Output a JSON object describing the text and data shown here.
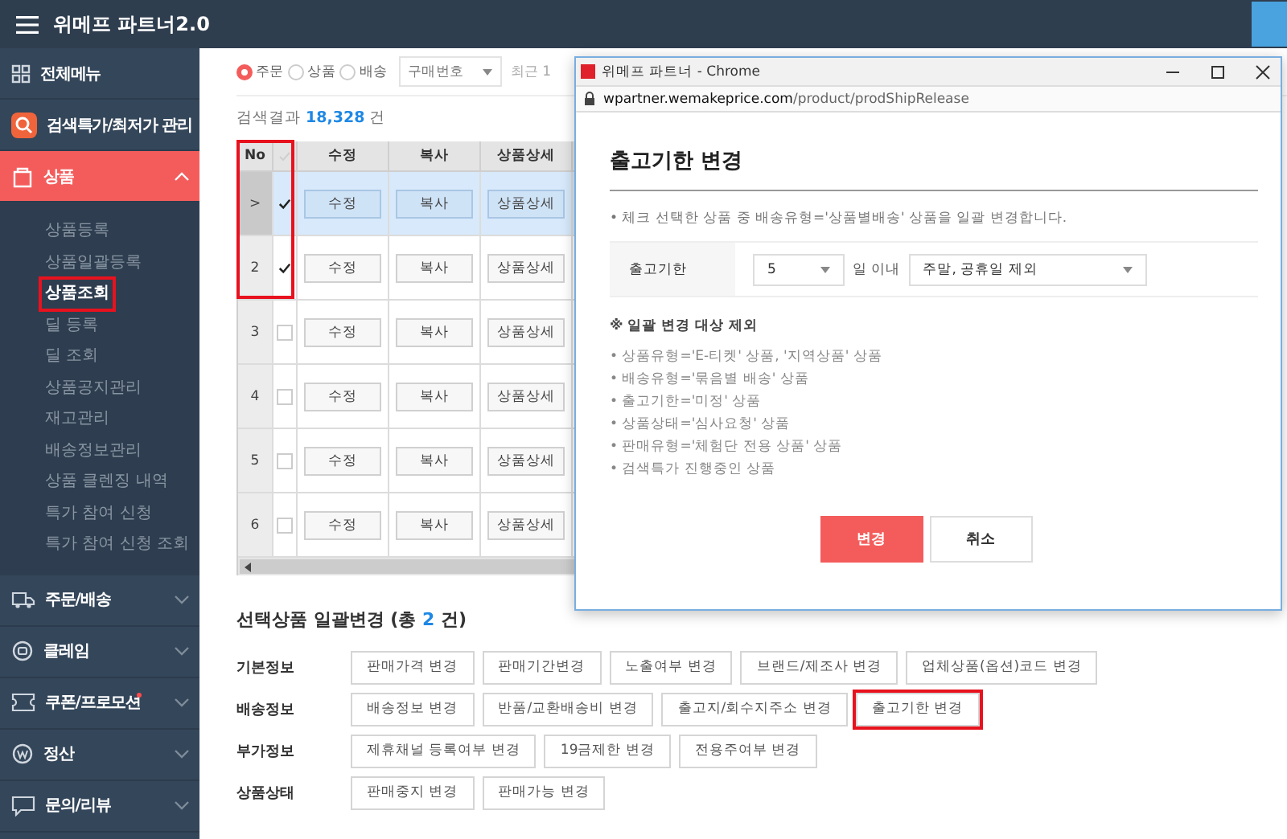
{
  "topbar": {
    "title": "위메프 파트너2.0"
  },
  "sidebar": {
    "items": [
      {
        "label": "전체메뉴",
        "selected": false,
        "new": false
      },
      {
        "label": "검색특가/최저가 관리",
        "selected": false,
        "new": false
      },
      {
        "label": "상품",
        "selected": true,
        "new": false,
        "expanded": true,
        "children": [
          {
            "label": "상품등록",
            "selected": false,
            "highlighted": false
          },
          {
            "label": "상품일괄등록",
            "selected": false,
            "highlighted": false
          },
          {
            "label": "상품조회",
            "selected": true,
            "highlighted": true
          },
          {
            "label": "딜 등록",
            "selected": false,
            "highlighted": false
          },
          {
            "label": "딜 조회",
            "selected": false,
            "highlighted": false
          },
          {
            "label": "상품공지관리",
            "selected": false,
            "highlighted": false
          },
          {
            "label": "재고관리",
            "selected": false,
            "highlighted": false
          },
          {
            "label": "배송정보관리",
            "selected": false,
            "highlighted": false
          },
          {
            "label": "상품 클렌징 내역",
            "selected": false,
            "highlighted": false
          },
          {
            "label": "특가 참여 신청",
            "selected": false,
            "highlighted": false
          },
          {
            "label": "특가 참여 신청 조회",
            "selected": false,
            "highlighted": false
          }
        ]
      },
      {
        "label": "주문/배송",
        "selected": false,
        "new": false,
        "expanded": false
      },
      {
        "label": "클레임",
        "selected": false,
        "new": false,
        "expanded": false
      },
      {
        "label": "쿠폰/프로모션",
        "selected": false,
        "new": true,
        "expanded": false
      },
      {
        "label": "정산",
        "selected": false,
        "new": false,
        "expanded": false
      },
      {
        "label": "문의/리뷰",
        "selected": false,
        "new": false,
        "expanded": false
      }
    ]
  },
  "filter": {
    "radios": [
      {
        "label": "주문",
        "selected": true
      },
      {
        "label": "상품",
        "selected": false
      },
      {
        "label": "배송",
        "selected": false
      }
    ],
    "dropdown": {
      "value": "구매번호"
    },
    "period": "최근 1"
  },
  "result": {
    "label": "검색결과",
    "count": "18,328",
    "unit": "건"
  },
  "table": {
    "columns": [
      "No",
      "수정",
      "복사",
      "상품상세"
    ],
    "rows": [
      {
        "no": ">",
        "checked": true,
        "selected": true,
        "highlighted": true,
        "buttons": [
          "수정",
          "복사",
          "상품상세"
        ]
      },
      {
        "no": "2",
        "checked": true,
        "selected": false,
        "highlighted": true,
        "buttons": [
          "수정",
          "복사",
          "상품상세"
        ]
      },
      {
        "no": "3",
        "checked": false,
        "selected": false,
        "highlighted": false,
        "buttons": [
          "수정",
          "복사",
          "상품상세"
        ]
      },
      {
        "no": "4",
        "checked": false,
        "selected": false,
        "highlighted": false,
        "buttons": [
          "수정",
          "복사",
          "상품상세"
        ]
      },
      {
        "no": "5",
        "checked": false,
        "selected": false,
        "highlighted": false,
        "buttons": [
          "수정",
          "복사",
          "상품상세"
        ]
      },
      {
        "no": "6",
        "checked": false,
        "selected": false,
        "highlighted": false,
        "buttons": [
          "수정",
          "복사",
          "상품상세"
        ]
      }
    ]
  },
  "bulk": {
    "title": "선택상품 일괄변경 (총 **2** 건)",
    "groups": [
      {
        "label": "기본정보",
        "buttons": [
          {
            "label": "판매가격 변경",
            "highlighted": false
          },
          {
            "label": "판매기간변경",
            "highlighted": false
          },
          {
            "label": "노출여부 변경",
            "highlighted": false
          },
          {
            "label": "브랜드/제조사 변경",
            "highlighted": false
          },
          {
            "label": "업체상품(옵션)코드 변경",
            "highlighted": false
          }
        ]
      },
      {
        "label": "배송정보",
        "buttons": [
          {
            "label": "배송정보 변경",
            "highlighted": false
          },
          {
            "label": "반품/교환배송비 변경",
            "highlighted": false
          },
          {
            "label": "출고지/회수지주소 변경",
            "highlighted": false
          },
          {
            "label": "출고기한 변경",
            "highlighted": true
          }
        ]
      },
      {
        "label": "부가정보",
        "buttons": [
          {
            "label": "제휴채널 등록여부 변경",
            "highlighted": false
          },
          {
            "label": "19금제한 변경",
            "highlighted": false
          },
          {
            "label": "전용주여부 변경",
            "highlighted": false
          }
        ]
      },
      {
        "label": "상품상태",
        "buttons": [
          {
            "label": "판매중지 변경",
            "highlighted": false
          },
          {
            "label": "판매가능 변경",
            "highlighted": false
          }
        ]
      }
    ]
  },
  "popup": {
    "title": "위메프 파트너 - Chrome",
    "url_host": "wpartner.wemakeprice.com",
    "url_path": "/product/prodShipRelease",
    "heading": "출고기한 변경",
    "note": "• 체크 선택한 상품 중 배송유형='상품별배송' 상품을 일괄 변경합니다.",
    "form": {
      "label": "출고기한",
      "days": "5",
      "days_unit": "일 이내",
      "option": "주말, 공휴일 제외"
    },
    "exclusions_title": "※ 일괄 변경 대상 제외",
    "exclusions": [
      "• 상품유형='E-티켓' 상품, '지역상품' 상품",
      "• 배송유형='묶음별 배송' 상품",
      "• 출고기한='미정' 상품",
      "• 상품상태='심사요청' 상품",
      "• 판매유형='체험단 전용 상품' 상품",
      "• 검색특가 진행중인 상품"
    ],
    "buttons": [
      {
        "label": "변경",
        "kind": "primary"
      },
      {
        "label": "취소",
        "kind": "secondary"
      }
    ]
  }
}
